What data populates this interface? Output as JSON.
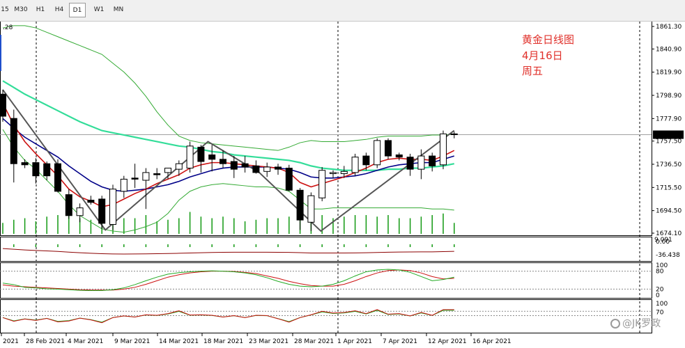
{
  "toolbar": {
    "timeframes": [
      {
        "label": "15",
        "active": false
      },
      {
        "label": "M30",
        "active": false
      },
      {
        "label": "H1",
        "active": false
      },
      {
        "label": "H4",
        "active": false
      },
      {
        "label": "D1",
        "active": true
      },
      {
        "label": "W1",
        "active": false
      },
      {
        "label": "MN",
        "active": false
      }
    ]
  },
  "annotation": {
    "line1": "黄金日线图",
    "line2": "4月16日",
    "line3": "周五"
  },
  "top_left_value": ".28",
  "watermark": "@JK罗政",
  "current_price": "1763.28",
  "price_axis_labels": [
    "1861.30",
    "1840.90",
    "1819.90",
    "1798.90",
    "1777.90",
    "1757.50",
    "1736.50",
    "1715.50",
    "1694.50",
    "1674.10"
  ],
  "macd_axis_labels": [
    "9.091",
    "0.00",
    "-36.438"
  ],
  "stoch_axis_labels": [
    "100",
    "80",
    "20",
    "0"
  ],
  "rsi_axis_labels": [
    "100",
    "70"
  ],
  "date_labels": [
    "2021",
    "28 Feb 2021",
    "4 Mar 2021",
    "9 Mar 2021",
    "14 Mar 2021",
    "18 Mar 2021",
    "23 Mar 2021",
    "28 Mar 2021",
    "1 Apr 2021",
    "7 Apr 2021",
    "12 Apr 2021",
    "16 Apr 2021"
  ],
  "colors": {
    "bull_candle": "#ffffff",
    "bear_candle": "#000000",
    "ma_fast": "#cc1111",
    "ma_mid": "#000088",
    "ma_slow": "#33dd99",
    "bollinger": "#33aa33",
    "zigzag": "#555555",
    "volume": "#119911",
    "annotation": "#e0312b"
  },
  "chart_data": {
    "type": "candlestick",
    "symbol": "XAUUSD",
    "timeframe": "D1",
    "y_range": [
      1674.1,
      1861.3
    ],
    "candles": [
      {
        "o": 1800,
        "h": 1804,
        "l": 1775,
        "c": 1780
      },
      {
        "o": 1778,
        "h": 1786,
        "l": 1720,
        "c": 1737
      },
      {
        "o": 1738,
        "h": 1741,
        "l": 1733,
        "c": 1736
      },
      {
        "o": 1738,
        "h": 1742,
        "l": 1719,
        "c": 1726
      },
      {
        "o": 1737,
        "h": 1739,
        "l": 1722,
        "c": 1726
      },
      {
        "o": 1737,
        "h": 1741,
        "l": 1711,
        "c": 1712
      },
      {
        "o": 1709,
        "h": 1714,
        "l": 1687,
        "c": 1690
      },
      {
        "o": 1690,
        "h": 1701,
        "l": 1684,
        "c": 1697
      },
      {
        "o": 1704,
        "h": 1708,
        "l": 1700,
        "c": 1702
      },
      {
        "o": 1705,
        "h": 1708,
        "l": 1678,
        "c": 1683
      },
      {
        "o": 1682,
        "h": 1718,
        "l": 1677,
        "c": 1714
      },
      {
        "o": 1712,
        "h": 1726,
        "l": 1706,
        "c": 1723
      },
      {
        "o": 1724,
        "h": 1737,
        "l": 1715,
        "c": 1723
      },
      {
        "o": 1722,
        "h": 1733,
        "l": 1696,
        "c": 1729
      },
      {
        "o": 1728,
        "h": 1733,
        "l": 1723,
        "c": 1727
      },
      {
        "o": 1729,
        "h": 1733,
        "l": 1723,
        "c": 1733
      },
      {
        "o": 1732,
        "h": 1740,
        "l": 1726,
        "c": 1737
      },
      {
        "o": 1733,
        "h": 1757,
        "l": 1729,
        "c": 1753
      },
      {
        "o": 1752,
        "h": 1754,
        "l": 1729,
        "c": 1739
      },
      {
        "o": 1745,
        "h": 1754,
        "l": 1730,
        "c": 1741
      },
      {
        "o": 1741,
        "h": 1749,
        "l": 1733,
        "c": 1737
      },
      {
        "o": 1739,
        "h": 1744,
        "l": 1724,
        "c": 1732
      },
      {
        "o": 1737,
        "h": 1744,
        "l": 1729,
        "c": 1734
      },
      {
        "o": 1735,
        "h": 1740,
        "l": 1728,
        "c": 1729
      },
      {
        "o": 1730,
        "h": 1738,
        "l": 1725,
        "c": 1734
      },
      {
        "o": 1734,
        "h": 1737,
        "l": 1727,
        "c": 1732
      },
      {
        "o": 1733,
        "h": 1736,
        "l": 1712,
        "c": 1713
      },
      {
        "o": 1713,
        "h": 1715,
        "l": 1677,
        "c": 1686
      },
      {
        "o": 1684,
        "h": 1711,
        "l": 1676,
        "c": 1708
      },
      {
        "o": 1706,
        "h": 1734,
        "l": 1703,
        "c": 1731
      },
      {
        "o": 1728,
        "h": 1731,
        "l": 1724,
        "c": 1729
      },
      {
        "o": 1728,
        "h": 1735,
        "l": 1724,
        "c": 1730
      },
      {
        "o": 1729,
        "h": 1746,
        "l": 1726,
        "c": 1743
      },
      {
        "o": 1744,
        "h": 1747,
        "l": 1731,
        "c": 1736
      },
      {
        "o": 1736,
        "h": 1760,
        "l": 1733,
        "c": 1758
      },
      {
        "o": 1758,
        "h": 1760,
        "l": 1741,
        "c": 1744
      },
      {
        "o": 1745,
        "h": 1747,
        "l": 1740,
        "c": 1743
      },
      {
        "o": 1743,
        "h": 1746,
        "l": 1726,
        "c": 1732
      },
      {
        "o": 1732,
        "h": 1750,
        "l": 1723,
        "c": 1744
      },
      {
        "o": 1744,
        "h": 1747,
        "l": 1730,
        "c": 1735
      },
      {
        "o": 1736,
        "h": 1767,
        "l": 1732,
        "c": 1764
      },
      {
        "o": 1764,
        "h": 1766,
        "l": 1760,
        "c": 1763.28
      }
    ],
    "ma_fast": [
      1792,
      1772,
      1757,
      1746,
      1736,
      1726,
      1714,
      1707,
      1703,
      1698,
      1700,
      1705,
      1710,
      1714,
      1719,
      1723,
      1727,
      1733,
      1736,
      1738,
      1738,
      1737,
      1736,
      1735,
      1734,
      1733,
      1729,
      1720,
      1716,
      1719,
      1722,
      1725,
      1729,
      1733,
      1738,
      1741,
      1742,
      1741,
      1741,
      1740,
      1744,
      1749
    ],
    "ma_mid": [
      1778,
      1769,
      1761,
      1755,
      1749,
      1743,
      1735,
      1728,
      1721,
      1716,
      1713,
      1712,
      1713,
      1714,
      1716,
      1718,
      1721,
      1725,
      1728,
      1731,
      1733,
      1734,
      1734,
      1734,
      1734,
      1733,
      1732,
      1729,
      1725,
      1724,
      1724,
      1725,
      1726,
      1728,
      1731,
      1734,
      1736,
      1737,
      1738,
      1738,
      1741,
      1744
    ],
    "ma_slow": [
      1812,
      1806,
      1800,
      1795,
      1790,
      1785,
      1780,
      1775,
      1771,
      1767,
      1765,
      1763,
      1761,
      1759,
      1757,
      1755,
      1753,
      1752,
      1750,
      1748,
      1747,
      1745,
      1744,
      1743,
      1742,
      1741,
      1740,
      1738,
      1735,
      1733,
      1732,
      1731,
      1731,
      1731,
      1731,
      1732,
      1732,
      1733,
      1733,
      1734,
      1735,
      1737
    ],
    "bb_upper": [
      1860,
      1862,
      1862,
      1860,
      1856,
      1852,
      1848,
      1844,
      1840,
      1836,
      1828,
      1820,
      1810,
      1798,
      1784,
      1772,
      1762,
      1758,
      1756,
      1755,
      1754,
      1753,
      1752,
      1751,
      1750,
      1749,
      1752,
      1756,
      1758,
      1757,
      1757,
      1757,
      1758,
      1759,
      1761,
      1762,
      1762,
      1762,
      1762,
      1763,
      1763,
      1764
    ],
    "bb_lower": [
      1768,
      1752,
      1740,
      1732,
      1722,
      1712,
      1700,
      1690,
      1684,
      1678,
      1676,
      1675,
      1677,
      1680,
      1684,
      1692,
      1704,
      1712,
      1716,
      1718,
      1719,
      1718,
      1717,
      1716,
      1716,
      1715,
      1712,
      1704,
      1696,
      1696,
      1697,
      1697,
      1697,
      1697,
      1697,
      1697,
      1697,
      1697,
      1697,
      1696,
      1696,
      1695
    ],
    "zigzag": [
      [
        0,
        1804
      ],
      [
        10,
        1677
      ],
      [
        20,
        1757
      ],
      [
        25,
        1729
      ],
      [
        31,
        1676
      ],
      [
        44,
        1767
      ]
    ],
    "volume": [
      0.35,
      0.45,
      0.5,
      0.4,
      0.55,
      0.6,
      0.7,
      0.5,
      0.45,
      0.55,
      0.8,
      0.5,
      0.5,
      0.6,
      0.4,
      0.45,
      0.5,
      0.7,
      0.55,
      0.5,
      0.55,
      0.5,
      0.4,
      0.45,
      0.5,
      0.5,
      0.55,
      0.7,
      0.75,
      0.6,
      0.5,
      0.55,
      0.6,
      0.6,
      0.55,
      0.6,
      0.5,
      0.5,
      0.55,
      0.6,
      0.65,
      0.35
    ],
    "stoch_main": [
      40,
      35,
      26,
      24,
      21,
      20,
      18,
      16,
      15,
      15,
      18,
      24,
      35,
      48,
      60,
      70,
      75,
      78,
      80,
      81,
      80,
      78,
      74,
      68,
      58,
      46,
      36,
      30,
      28,
      30,
      36,
      48,
      64,
      78,
      84,
      86,
      84,
      76,
      62,
      48,
      52,
      60
    ],
    "stoch_signal": [
      34,
      30,
      28,
      26,
      24,
      22,
      20,
      18,
      17,
      17,
      17,
      20,
      26,
      36,
      48,
      60,
      68,
      74,
      78,
      80,
      80,
      79,
      76,
      72,
      64,
      56,
      46,
      38,
      32,
      30,
      30,
      36,
      48,
      62,
      74,
      82,
      84,
      82,
      74,
      62,
      54,
      56
    ],
    "rsi": [
      48,
      35,
      43,
      38,
      45,
      33,
      36,
      46,
      40,
      30,
      48,
      54,
      50,
      58,
      56,
      62,
      72,
      57,
      58,
      56,
      50,
      55,
      48,
      56,
      55,
      44,
      32,
      48,
      58,
      70,
      64,
      66,
      72,
      62,
      76,
      60,
      62,
      54,
      66,
      56,
      76,
      76
    ]
  }
}
